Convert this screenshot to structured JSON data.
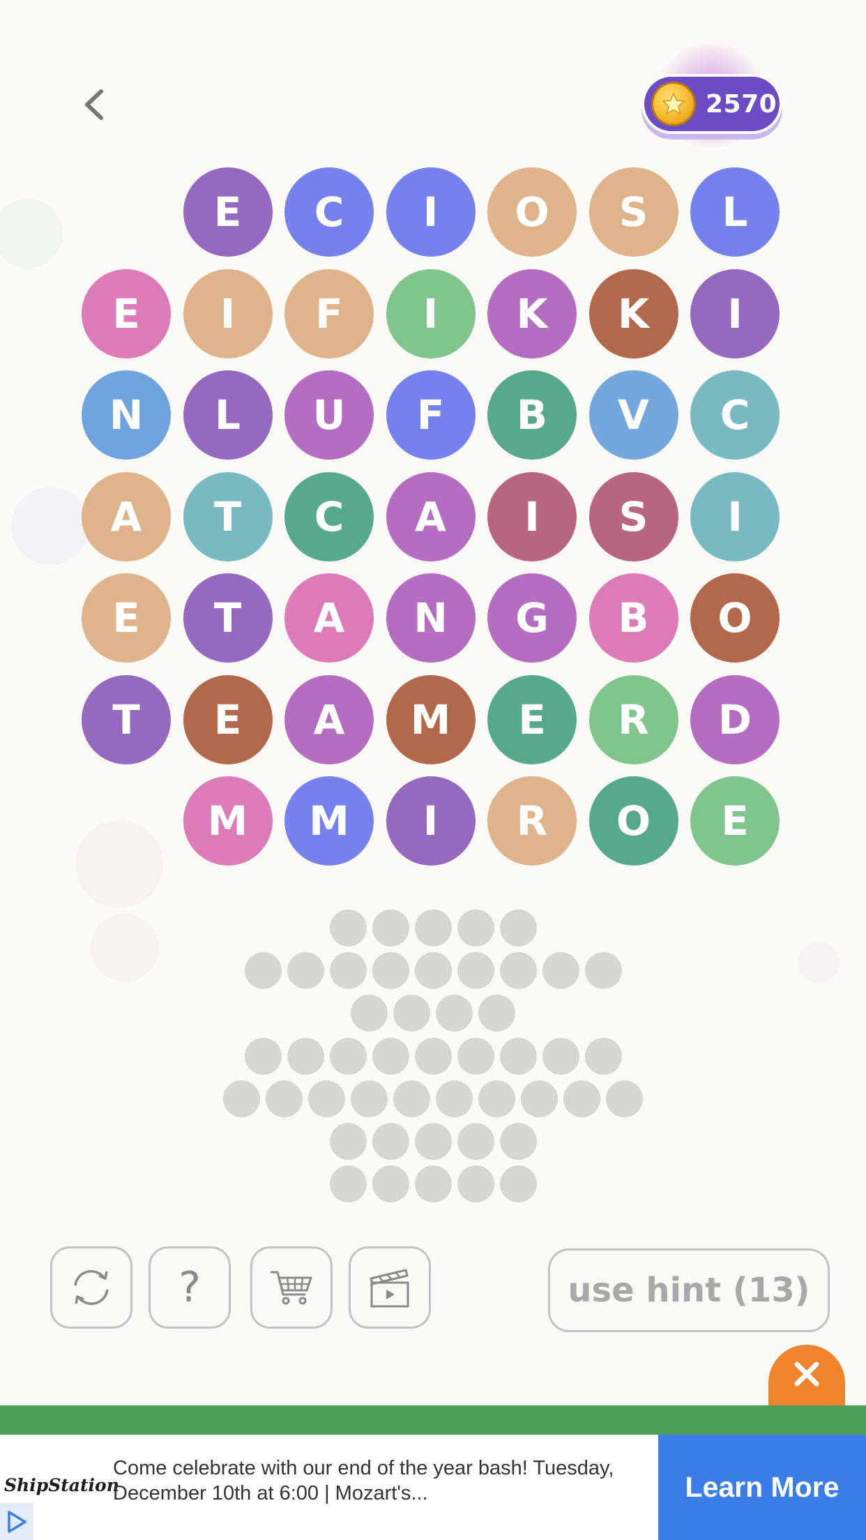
{
  "header": {
    "back_icon": "chevron-left-icon",
    "coin_icon": "star-coin-icon",
    "coins": "2570"
  },
  "board": {
    "rows": [
      [
        "E",
        "C",
        "I",
        "O",
        "S",
        "L"
      ],
      [
        "E",
        "I",
        "F",
        "I",
        "K",
        "K",
        "I"
      ],
      [
        "N",
        "L",
        "U",
        "F",
        "B",
        "V",
        "C"
      ],
      [
        "A",
        "T",
        "C",
        "A",
        "I",
        "S",
        "I"
      ],
      [
        "E",
        "T",
        "A",
        "N",
        "G",
        "B",
        "O"
      ],
      [
        "T",
        "E",
        "A",
        "M",
        "E",
        "R",
        "D"
      ],
      [
        "M",
        "M",
        "I",
        "R",
        "O",
        "E"
      ]
    ],
    "colors": [
      [
        "#9569c0",
        "#7582ed",
        "#7582ed",
        "#dfb48a",
        "#dfb48a",
        "#7582ed"
      ],
      [
        "#dd7bb8",
        "#dfb48a",
        "#dfb48a",
        "#80c48e",
        "#b56dc2",
        "#b1684b",
        "#9569c0"
      ],
      [
        "#6fa3dd",
        "#9569c0",
        "#b56dc2",
        "#7582ed",
        "#56a98a",
        "#74a7dd",
        "#79bac2"
      ],
      [
        "#dfb48a",
        "#79bac2",
        "#56a98a",
        "#b56dc2",
        "#b86582",
        "#b86582",
        "#79bac2"
      ],
      [
        "#dfb48a",
        "#9569c0",
        "#dd7bb8",
        "#b56dc2",
        "#b56dc2",
        "#dd7bb8",
        "#b1684b"
      ],
      [
        "#9569c0",
        "#b1684b",
        "#b56dc2",
        "#b1684b",
        "#56a98a",
        "#80c48e",
        "#b56dc2"
      ],
      [
        "#dd7bb8",
        "#7582ed",
        "#9569c0",
        "#dfb48a",
        "#56a98a",
        "#80c48e"
      ]
    ]
  },
  "answer_slots": [
    5,
    9,
    4,
    9,
    10,
    5,
    5
  ],
  "toolbar": {
    "buttons": [
      {
        "icon": "shuffle-icon"
      },
      {
        "icon": "question-mark-icon",
        "label": "?"
      },
      {
        "icon": "shopping-cart-icon"
      },
      {
        "icon": "video-clapperboard-icon"
      }
    ],
    "hint_label": "use hint (13)"
  },
  "ad": {
    "close_icon": "close-icon",
    "brand": "ShipStation",
    "text": "Come celebrate with our end of the year bash! Tuesday, December 10th at 6:00 | Mozart's...",
    "cta": "Learn More",
    "play_icon": "ad-choices-play-icon"
  },
  "colors": {
    "background": "#fbfaf6",
    "coin_pill": "#6b4cc4",
    "slot": "#d8d6d1",
    "ad_close": "#f0832d",
    "ad_stripe": "#4a9e58",
    "ad_cta": "#3a7de9"
  }
}
